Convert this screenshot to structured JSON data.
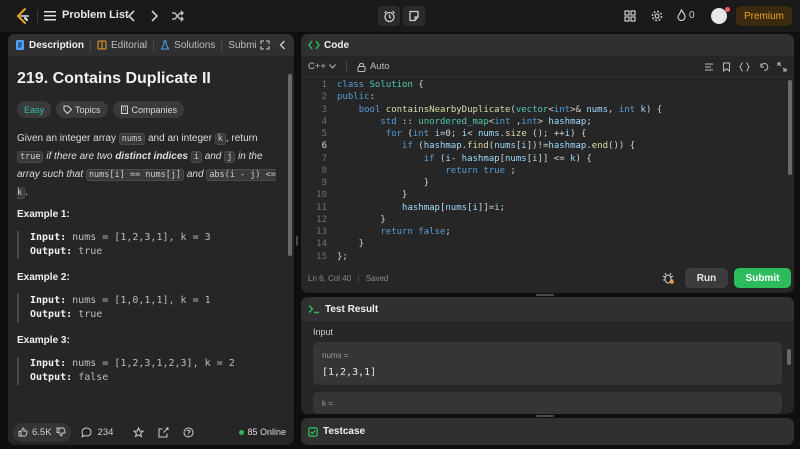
{
  "topbar": {
    "problem_list_label": "Problem List",
    "streak_count": "0",
    "premium_label": "Premium"
  },
  "left": {
    "tabs": [
      {
        "label": "Description"
      },
      {
        "label": "Editorial"
      },
      {
        "label": "Solutions"
      },
      {
        "label": "Submi"
      }
    ],
    "title": "219. Contains Duplicate II",
    "tags": {
      "difficulty": "Easy",
      "topics": "Topics",
      "companies": "Companies"
    },
    "description": {
      "p1": "Given an integer array",
      "nums": "nums",
      "p2": "and an integer",
      "k": "k",
      "p3": ", return",
      "true": "true",
      "p4": "if there are two",
      "distinct": "distinct indices",
      "i": "i",
      "p5": "and",
      "j": "j",
      "p6": "in the array such that",
      "cond1": "nums[i] == nums[j]",
      "p7": "and",
      "cond2": "abs(i - j) <= k",
      "p8": "."
    },
    "examples": [
      {
        "title": "Example 1:",
        "input_label": "Input:",
        "input": "nums = [1,2,3,1], k = 3",
        "output_label": "Output:",
        "output": "true"
      },
      {
        "title": "Example 2:",
        "input_label": "Input:",
        "input": "nums = [1,0,1,1], k = 1",
        "output_label": "Output:",
        "output": "true"
      },
      {
        "title": "Example 3:",
        "input_label": "Input:",
        "input": "nums = [1,2,3,1,2,3], k = 2",
        "output_label": "Output:",
        "output": "false"
      }
    ],
    "footer": {
      "likes": "6.5K",
      "comments": "234",
      "online": "85 Online"
    }
  },
  "code": {
    "tab_label": "Code",
    "language": "C++",
    "auto_label": "Auto",
    "status": "Ln 6, Col 40",
    "saved": "Saved",
    "run_label": "Run",
    "submit_label": "Submit",
    "current_line": 6,
    "lines": [
      "class Solution {",
      "public:",
      "    bool containsNearbyDuplicate(vector<int>& nums, int k) {",
      "        std :: unordered_map<int ,int> hashmap;",
      "         for (int i=0; i< nums.size (); ++i) {",
      "            if (hashmap.find(nums[i])!=hashmap.end()) {",
      "                if (i- hashmap[nums[i]] <= k) {",
      "                    return true ;",
      "                }",
      "            }",
      "            hashmap[nums[i]]=i;",
      "        }",
      "        return false;",
      "    }",
      "};"
    ]
  },
  "test": {
    "header": "Test Result",
    "input_label": "Input",
    "var1_name": "nums =",
    "var1_value": "[1,2,3,1]",
    "var2_name": "k ="
  },
  "testcase": {
    "header": "Testcase"
  },
  "colors": {
    "accent_green": "#2cbb5d",
    "premium": "#f0a428",
    "easy": "#2bc6b2"
  }
}
